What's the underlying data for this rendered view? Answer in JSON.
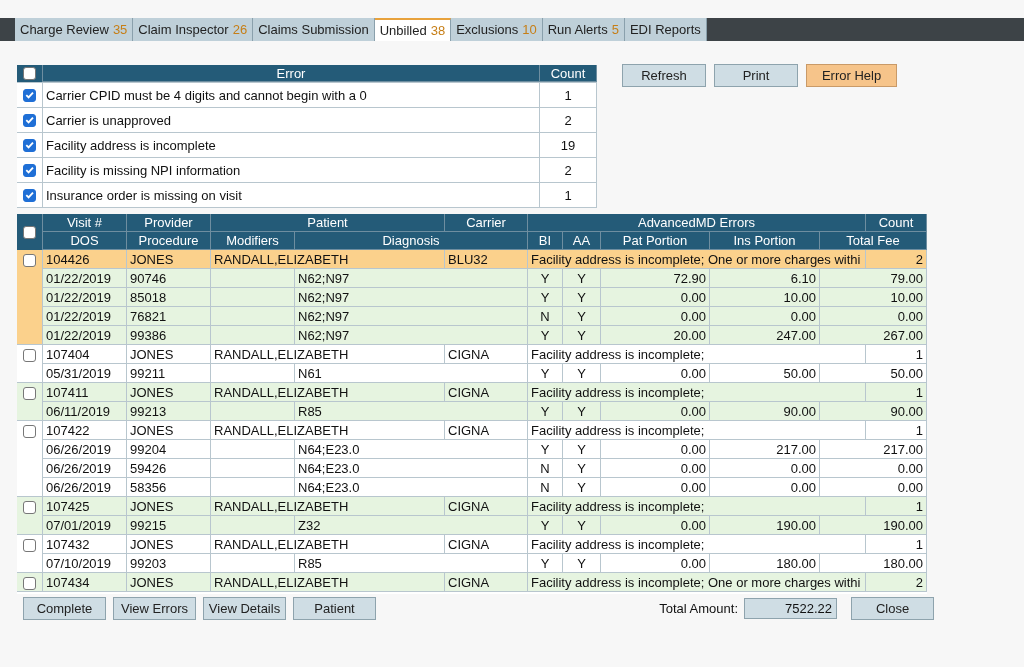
{
  "tabs": [
    {
      "label": "Charge Review",
      "count": "35",
      "selected": false
    },
    {
      "label": "Claim Inspector",
      "count": "26",
      "selected": false
    },
    {
      "label": "Claims Submission",
      "selected": false
    },
    {
      "label": "Unbilled",
      "count": "38",
      "selected": true
    },
    {
      "label": "Exclusions",
      "count": "10",
      "selected": false
    },
    {
      "label": "Run Alerts",
      "count": "5",
      "selected": false
    },
    {
      "label": "EDI Reports",
      "selected": false
    }
  ],
  "error_table": {
    "select_all_checked": false,
    "columns": [
      "Error",
      "Count"
    ],
    "rows": [
      {
        "error": "Carrier CPID must be 4 digits and cannot begin with a 0",
        "count": "1",
        "checked": true
      },
      {
        "error": "Carrier is unapproved",
        "count": "2",
        "checked": true
      },
      {
        "error": "Facility address is incomplete",
        "count": "19",
        "checked": true
      },
      {
        "error": "Facility is missing NPI information",
        "count": "2",
        "checked": true
      },
      {
        "error": "Insurance order is missing on visit",
        "count": "1",
        "checked": true
      }
    ]
  },
  "actions": [
    {
      "label": "Refresh",
      "kind": "plain"
    },
    {
      "label": "Print",
      "kind": "plain"
    },
    {
      "label": "Error Help",
      "kind": "accent"
    }
  ],
  "visit_table": {
    "select_all_checked": false,
    "header_row_1": [
      "Visit #",
      "Provider",
      "Patient",
      "Carrier",
      "AdvancedMD Errors",
      "Count"
    ],
    "header_row_2": [
      "DOS",
      "Procedure",
      "Modifiers",
      "Diagnosis",
      "BI",
      "AA",
      "Pat Portion",
      "Ins Portion",
      "Total Fee"
    ],
    "visits": [
      {
        "visit": "104426",
        "provider": "JONES",
        "patient": "RANDALL,ELIZABETH",
        "carrier": "BLU32",
        "errors": "Facility address is incomplete; One or more charges withi",
        "count": "2",
        "checked": false,
        "selected": true,
        "shaded": true,
        "charges": [
          {
            "dos": "01/22/2019",
            "procedure": "90746",
            "diagnosis": "N62;N97",
            "bi": "Y",
            "aa": "Y",
            "pat": "72.90",
            "ins": "6.10",
            "total": "79.00"
          },
          {
            "dos": "01/22/2019",
            "procedure": "85018",
            "diagnosis": "N62;N97",
            "bi": "Y",
            "aa": "Y",
            "pat": "0.00",
            "ins": "10.00",
            "total": "10.00"
          },
          {
            "dos": "01/22/2019",
            "procedure": "76821",
            "diagnosis": "N62;N97",
            "bi": "N",
            "aa": "Y",
            "pat": "0.00",
            "ins": "0.00",
            "total": "0.00"
          },
          {
            "dos": "01/22/2019",
            "procedure": "99386",
            "diagnosis": "N62;N97",
            "bi": "Y",
            "aa": "Y",
            "pat": "20.00",
            "ins": "247.00",
            "total": "267.00"
          }
        ]
      },
      {
        "visit": "107404",
        "provider": "JONES",
        "patient": "RANDALL,ELIZABETH",
        "carrier": "CIGNA",
        "errors": "Facility address is incomplete;",
        "count": "1",
        "checked": false,
        "selected": false,
        "shaded": false,
        "charges": [
          {
            "dos": "05/31/2019",
            "procedure": "99211",
            "diagnosis": "N61",
            "bi": "Y",
            "aa": "Y",
            "pat": "0.00",
            "ins": "50.00",
            "total": "50.00"
          }
        ]
      },
      {
        "visit": "107411",
        "provider": "JONES",
        "patient": "RANDALL,ELIZABETH",
        "carrier": "CIGNA",
        "errors": "Facility address is incomplete;",
        "count": "1",
        "checked": false,
        "selected": false,
        "shaded": true,
        "charges": [
          {
            "dos": "06/11/2019",
            "procedure": "99213",
            "diagnosis": "R85",
            "bi": "Y",
            "aa": "Y",
            "pat": "0.00",
            "ins": "90.00",
            "total": "90.00"
          }
        ]
      },
      {
        "visit": "107422",
        "provider": "JONES",
        "patient": "RANDALL,ELIZABETH",
        "carrier": "CIGNA",
        "errors": "Facility address is incomplete;",
        "count": "1",
        "checked": false,
        "selected": false,
        "shaded": false,
        "charges": [
          {
            "dos": "06/26/2019",
            "procedure": "99204",
            "diagnosis": "N64;E23.0",
            "bi": "Y",
            "aa": "Y",
            "pat": "0.00",
            "ins": "217.00",
            "total": "217.00"
          },
          {
            "dos": "06/26/2019",
            "procedure": "59426",
            "diagnosis": "N64;E23.0",
            "bi": "N",
            "aa": "Y",
            "pat": "0.00",
            "ins": "0.00",
            "total": "0.00"
          },
          {
            "dos": "06/26/2019",
            "procedure": "58356",
            "diagnosis": "N64;E23.0",
            "bi": "N",
            "aa": "Y",
            "pat": "0.00",
            "ins": "0.00",
            "total": "0.00"
          }
        ]
      },
      {
        "visit": "107425",
        "provider": "JONES",
        "patient": "RANDALL,ELIZABETH",
        "carrier": "CIGNA",
        "errors": "Facility address is incomplete;",
        "count": "1",
        "checked": false,
        "selected": false,
        "shaded": true,
        "charges": [
          {
            "dos": "07/01/2019",
            "procedure": "99215",
            "diagnosis": "Z32",
            "bi": "Y",
            "aa": "Y",
            "pat": "0.00",
            "ins": "190.00",
            "total": "190.00"
          }
        ]
      },
      {
        "visit": "107432",
        "provider": "JONES",
        "patient": "RANDALL,ELIZABETH",
        "carrier": "CIGNA",
        "errors": "Facility address is incomplete;",
        "count": "1",
        "checked": false,
        "selected": false,
        "shaded": false,
        "charges": [
          {
            "dos": "07/10/2019",
            "procedure": "99203",
            "diagnosis": "R85",
            "bi": "Y",
            "aa": "Y",
            "pat": "0.00",
            "ins": "180.00",
            "total": "180.00"
          }
        ]
      },
      {
        "visit": "107434",
        "provider": "JONES",
        "patient": "RANDALL,ELIZABETH",
        "carrier": "CIGNA",
        "errors": "Facility address is incomplete; One or more charges withi",
        "count": "2",
        "checked": false,
        "selected": false,
        "shaded": true
      }
    ]
  },
  "footer_buttons": [
    "Complete",
    "View Errors",
    "View Details",
    "Patient"
  ],
  "total_amount": {
    "label": "Total Amount:",
    "value": "7522.22"
  },
  "close_button": "Close"
}
